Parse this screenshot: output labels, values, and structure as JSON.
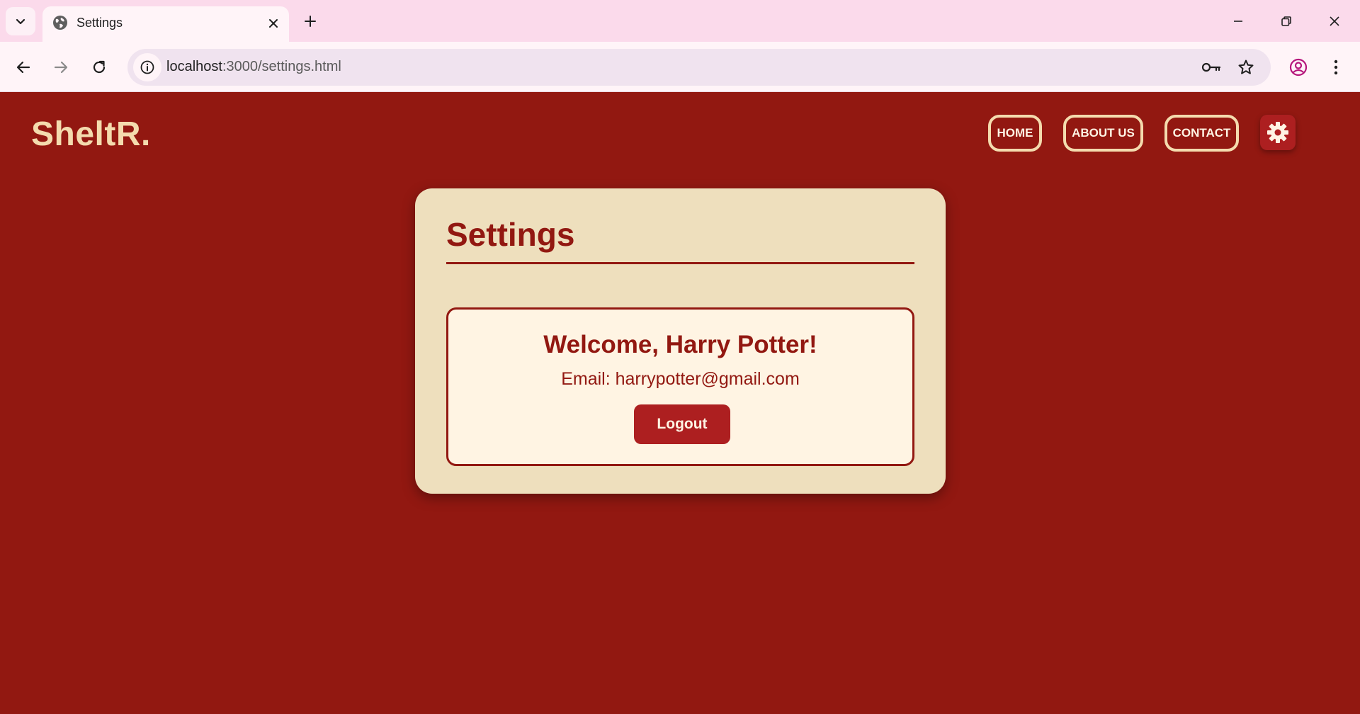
{
  "browser": {
    "tab_title": "Settings",
    "url_host": "localhost",
    "url_path": ":3000/settings.html",
    "icons": [
      "tab-list-icon",
      "globe-icon",
      "close-icon",
      "plus-icon",
      "minimize-icon",
      "restore-icon",
      "window-close-icon",
      "back-arrow-icon",
      "forward-arrow-icon",
      "reload-icon",
      "info-icon",
      "key-icon",
      "star-icon",
      "profile-icon",
      "more-vert-icon"
    ]
  },
  "header": {
    "logo": "SheltR.",
    "nav": {
      "home": "HOME",
      "about": "ABOUT US",
      "contact": "CONTACT"
    },
    "settings_icon": "gear-icon"
  },
  "settings": {
    "title": "Settings",
    "welcome": "Welcome, Harry Potter!",
    "email": "Email: harrypotter@gmail.com",
    "logout_label": "Logout"
  },
  "colors": {
    "background": "#921811",
    "card": "#eedfbd",
    "panel": "#fff4e3",
    "accent": "#ad1f20",
    "logo": "#f4dbae"
  }
}
